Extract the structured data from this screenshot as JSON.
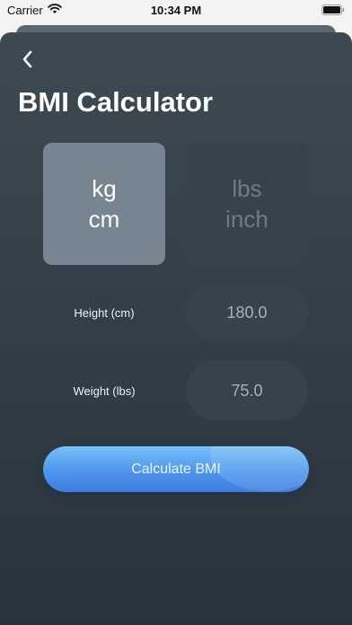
{
  "status": {
    "carrier": "Carrier",
    "time": "10:34 PM"
  },
  "title": "BMI Calculator",
  "units": {
    "metric": {
      "weight_unit": "kg",
      "height_unit": "cm"
    },
    "imperial": {
      "weight_unit": "lbs",
      "height_unit": "inch"
    }
  },
  "form": {
    "height_label": "Height (cm)",
    "height_value": "180.0",
    "weight_label": "Weight (lbs)",
    "weight_value": "75.0"
  },
  "calculate_label": "Calculate BMI",
  "colors": {
    "accent": "#4d96ee",
    "selected_card": "#76858f",
    "unselected_card": "#37424b"
  }
}
